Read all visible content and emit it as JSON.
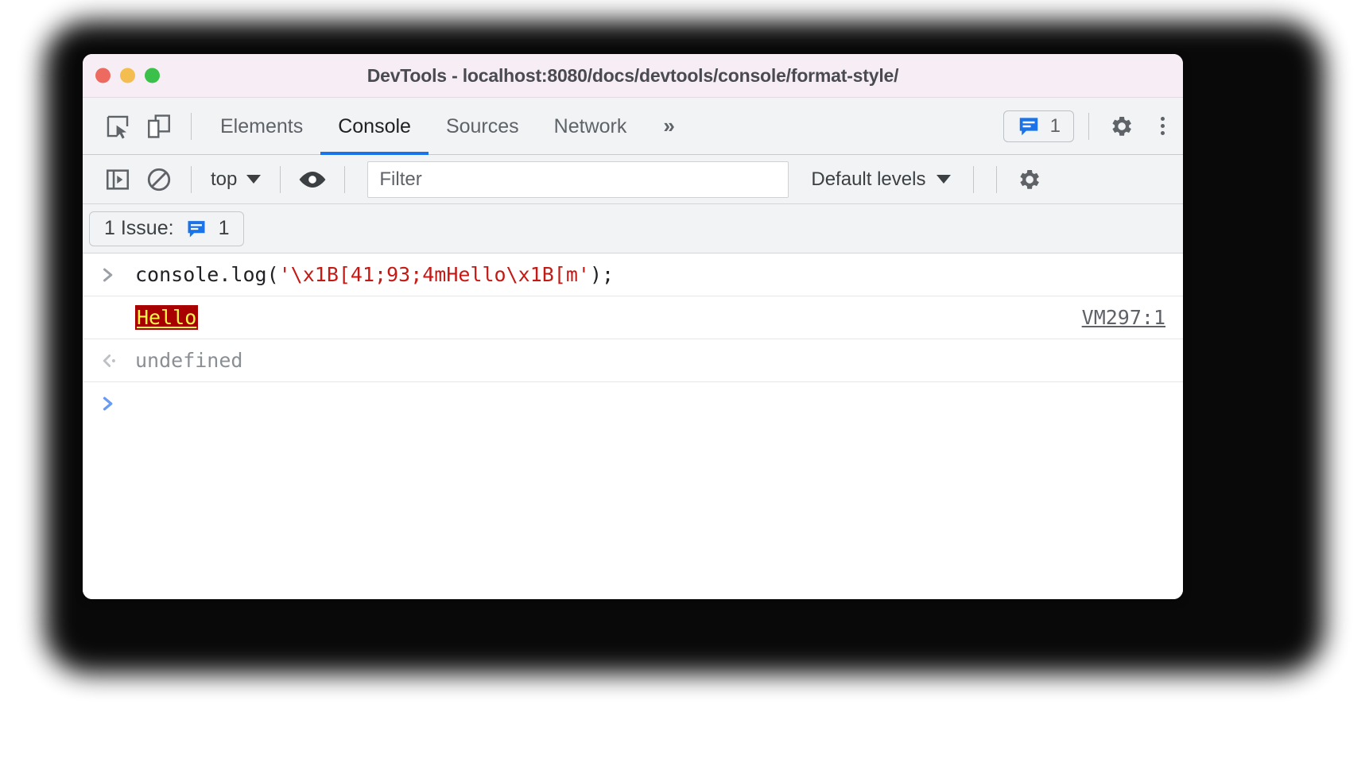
{
  "window": {
    "title": "DevTools - localhost:8080/docs/devtools/console/format-style/",
    "traffic_lights": [
      "close",
      "minimize",
      "zoom"
    ]
  },
  "tabbar": {
    "inspect_icon": "inspect-element-icon",
    "device_icon": "device-toolbar-icon",
    "tabs": [
      {
        "label": "Elements",
        "active": false
      },
      {
        "label": "Console",
        "active": true
      },
      {
        "label": "Sources",
        "active": false
      },
      {
        "label": "Network",
        "active": false
      }
    ],
    "more_tabs": "»",
    "issues_count": "1",
    "issues_icon": "issues-message-icon",
    "settings_icon": "gear-icon",
    "more_icon": "kebab-menu-icon",
    "active_tab_underline_color": "#1a73e8"
  },
  "console_toolbar": {
    "sidebar_toggle_icon": "console-sidebar-icon",
    "clear_icon": "clear-console-icon",
    "context": "top",
    "context_caret": "▼",
    "eye_icon": "live-expression-eye-icon",
    "filter_placeholder": "Filter",
    "filter_value": "",
    "levels_label": "Default levels",
    "levels_caret": "▼",
    "settings_icon": "console-settings-gear-icon"
  },
  "issues_bar": {
    "label": "1 Issue:",
    "badge_icon": "issues-message-icon",
    "count": "1"
  },
  "console": {
    "rows": [
      {
        "type": "input",
        "gutter_icon": "input-prompt-arrow",
        "code_plain_1": "console.log(",
        "code_string": "'\\x1B[41;93;4mHello\\x1B[m'",
        "code_plain_2": ");"
      },
      {
        "type": "output",
        "text": "Hello",
        "bg_color": "#a80000",
        "fg_color": "#fcf84a",
        "underline": true,
        "source": "VM297:1"
      },
      {
        "type": "result",
        "gutter_icon": "return-value-arrow",
        "value": "undefined"
      },
      {
        "type": "entry",
        "gutter_icon": "console-prompt-chevron",
        "value": ""
      }
    ]
  }
}
